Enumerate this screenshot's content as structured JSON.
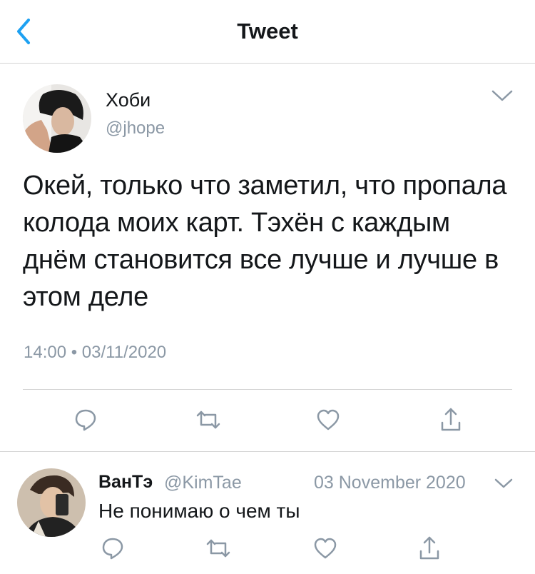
{
  "header": {
    "title": "Tweet",
    "back_icon": "chevron-left-icon"
  },
  "colors": {
    "accent": "#1da1f2",
    "muted": "#8b98a5",
    "text": "#14171a",
    "divider": "#d4d4d4"
  },
  "tweet": {
    "author_name": "Хоби",
    "author_handle": "@jhope",
    "text": "Окей, только что заметил, что пропала колода моих карт. Тэхён с каждым днём становится все лучше и лучше в этом деле",
    "timestamp": "14:00 • 03/11/2020",
    "actions": [
      "reply-icon",
      "retweet-icon",
      "like-icon",
      "share-icon"
    ]
  },
  "reply": {
    "author_name": "ВанТэ",
    "author_handle": "@KimTae",
    "date": "03 November 2020",
    "text": "Не понимаю о чем ты",
    "actions": [
      "reply-icon",
      "retweet-icon",
      "like-icon",
      "share-icon"
    ]
  }
}
